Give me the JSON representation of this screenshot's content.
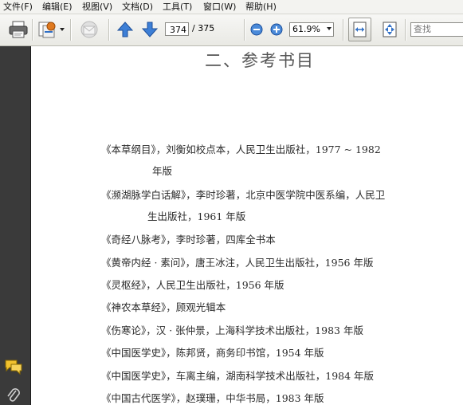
{
  "menu": [
    "文件(F)",
    "编辑(E)",
    "视图(V)",
    "文档(D)",
    "工具(T)",
    "窗口(W)",
    "帮助(H)"
  ],
  "toolbar": {
    "current_page": "374",
    "total_pages": "/ 375",
    "zoom": "61.9%",
    "search_placeholder": "查找",
    "icons": [
      "print-icon",
      "save-icon",
      "email-icon",
      "previous-page-icon",
      "next-page-icon",
      "zoom-out-icon",
      "zoom-in-icon",
      "fit-width-icon",
      "fit-page-icon"
    ]
  },
  "left_panel": {
    "icons": [
      "comments-icon",
      "attachments-icon"
    ]
  },
  "document": {
    "title": "二、参考书目",
    "lines": [
      "《本草纲目》，刘衡如校点本，人民卫生出版社，1977 ~ 1982",
      "年版",
      "《濒湖脉学白话解》，李时珍著，北京中医学院中医系编，人民卫",
      "生出版社，1961 年版",
      "《奇经八脉考》，李时珍著，四库全书本",
      "《黄帝内经 · 素问》，唐王冰注，人民卫生出版社，1956 年版",
      "《灵枢经》，人民卫生出版社，1956 年版",
      "《神农本草经》，顾观光辑本",
      "《伤寒论》，汉 · 张仲景，上海科学技术出版社，1983 年版",
      "《中国医学史》，陈邦贤，商务印书馆，1954 年版",
      "《中国医学史》，车离主编，湖南科学技术出版社，1984 年版",
      "《中国古代医学》，赵璞珊，中华书局，1983 年版"
    ]
  }
}
